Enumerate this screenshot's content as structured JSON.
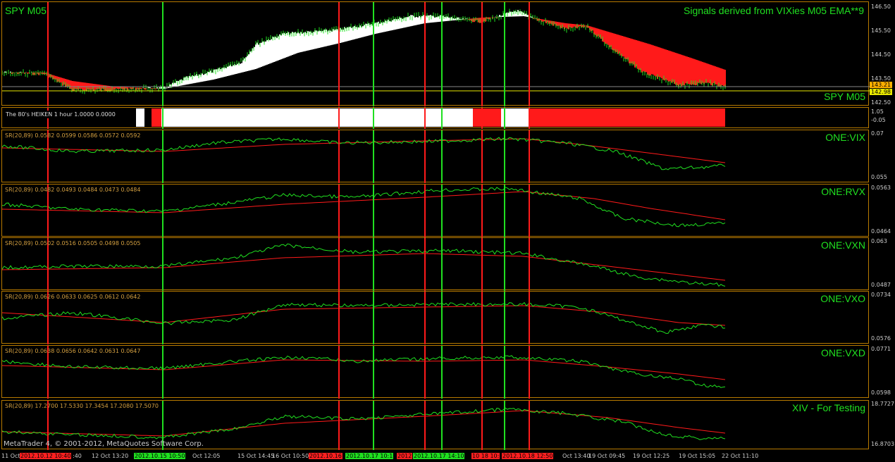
{
  "colors": {
    "green": "#20e020",
    "red": "#ff1a1a",
    "border": "#b87a00",
    "white": "#ffffff",
    "price_hl": "#ffb000"
  },
  "main": {
    "title": "SPY M05",
    "signal_title": "Signals derived from VIXies M05 EMA**9",
    "footer_label": "SPY M05",
    "scale": [
      "146.50",
      "145.50",
      "144.50",
      "143.50",
      "142.50"
    ],
    "price_tag_1": "143.21",
    "price_tag_2": "142.98"
  },
  "heiken": {
    "label": "The 80's HEIKEN 1 hour 1.0000 0.0000",
    "scale": [
      "1.05",
      "-0.05"
    ],
    "segments": [
      "white",
      "red",
      "white",
      "red",
      "white",
      "red"
    ]
  },
  "subpanels": [
    {
      "name": "ONE:VIX",
      "info": "SR(20,89) 0.0582 0.0599 0.0586 0.0572 0.0592",
      "scale_top": "0.07",
      "scale_bottom": "0.055"
    },
    {
      "name": "ONE:RVX",
      "info": "SR(20,89) 0.0482 0.0493 0.0484 0.0473 0.0484",
      "scale_top": "0.0563",
      "scale_bottom": "0.0464"
    },
    {
      "name": "ONE:VXN",
      "info": "SR(20,89) 0.0502 0.0516 0.0505 0.0498 0.0505",
      "scale_top": "0.063",
      "scale_bottom": "0.0487"
    },
    {
      "name": "ONE:VXO",
      "info": "SR(20,89) 0.0626 0.0633 0.0625 0.0612 0.0642",
      "scale_top": "0.0734",
      "scale_bottom": "0.0576"
    },
    {
      "name": "ONE:VXD",
      "info": "SR(20,89) 0.0638 0.0656 0.0642 0.0631 0.0647",
      "scale_top": "0.0771",
      "scale_bottom": "0.0598"
    },
    {
      "name": "XIV - For Testing",
      "info": "SR(20,89) 17.2700 17.5330 17.3454 17.2080 17.5070",
      "scale_top": "18.7727",
      "scale_bottom": "16.8703"
    }
  ],
  "copyright": "MetaTrader 4, © 2001-2012, MetaQuotes Software Corp.",
  "time_axis": [
    {
      "text": "11 Oct",
      "hl": ""
    },
    {
      "text": "2012.10.12 10:40",
      "hl": "red"
    },
    {
      "text": ":40",
      "hl": ""
    },
    {
      "text": "12 Oct 13:20",
      "hl": ""
    },
    {
      "text": "2012.10.15 10:50",
      "hl": "green"
    },
    {
      "text": "Oct 12:05",
      "hl": ""
    },
    {
      "text": "15 Oct 14:45",
      "hl": ""
    },
    {
      "text": "16 Oct 10:50",
      "hl": ""
    },
    {
      "text": "2012.10.16",
      "hl": "red"
    },
    {
      "text": "2012.10.17 10:1",
      "hl": "green"
    },
    {
      "text": "2012",
      "hl": "red"
    },
    {
      "text": "2012.10.17 14:10",
      "hl": "green"
    },
    {
      "text": "10 18 10:",
      "hl": "red"
    },
    {
      "text": "2012.10.18 12:50",
      "hl": "red"
    },
    {
      "text": "Oct 13:40",
      "hl": ""
    },
    {
      "text": "19 Oct 09:45",
      "hl": ""
    },
    {
      "text": "19 Oct 12:25",
      "hl": ""
    },
    {
      "text": "19 Oct 15:05",
      "hl": ""
    },
    {
      "text": "22 Oct 11:10",
      "hl": ""
    }
  ]
}
